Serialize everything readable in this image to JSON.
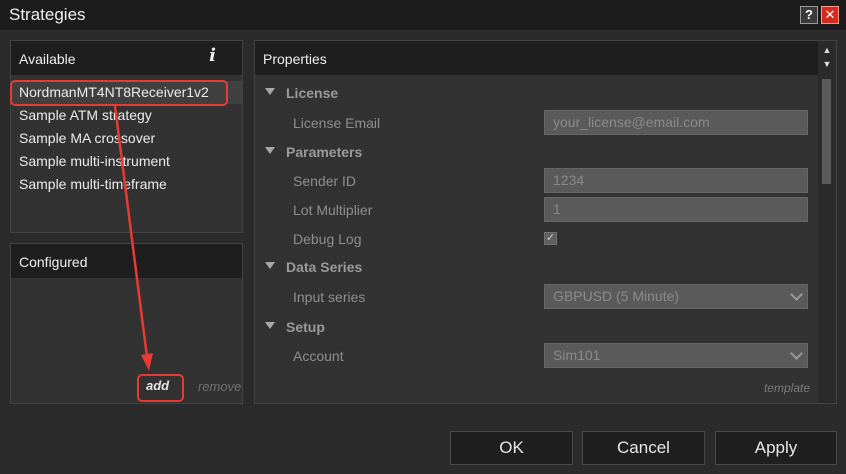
{
  "window": {
    "title": "Strategies",
    "help_glyph": "?",
    "close_glyph": "✕"
  },
  "available": {
    "header": "Available",
    "info_glyph": "i",
    "items": [
      {
        "label": "NordmanMT4NT8Receiver1v2"
      },
      {
        "label": "Sample ATM strategy"
      },
      {
        "label": "Sample MA crossover"
      },
      {
        "label": "Sample multi-instrument"
      },
      {
        "label": "Sample multi-timeframe"
      }
    ]
  },
  "configured": {
    "header": "Configured",
    "add_label": "add",
    "remove_label": "remove"
  },
  "properties": {
    "header": "Properties",
    "categories": {
      "license": "License",
      "parameters": "Parameters",
      "data_series": "Data Series",
      "setup": "Setup"
    },
    "fields": {
      "license_email": {
        "label": "License Email",
        "value": "your_license@email.com"
      },
      "sender_id": {
        "label": "Sender ID",
        "value": "1234"
      },
      "lot_multiplier": {
        "label": "Lot Multiplier",
        "value": "1"
      },
      "debug_log": {
        "label": "Debug Log",
        "checked": true,
        "check_glyph": "✓"
      },
      "input_series": {
        "label": "Input series",
        "value": "GBPUSD (5 Minute)"
      },
      "account": {
        "label": "Account",
        "value": "Sim101"
      }
    },
    "template_label": "template",
    "scroll_up_glyph": "▲",
    "scroll_down_glyph": "▼"
  },
  "buttons": {
    "ok": "OK",
    "cancel": "Cancel",
    "apply": "Apply"
  },
  "colors": {
    "annotation": "#e83a32",
    "close_button": "#d52b1e",
    "background": "#2b2b2b"
  }
}
